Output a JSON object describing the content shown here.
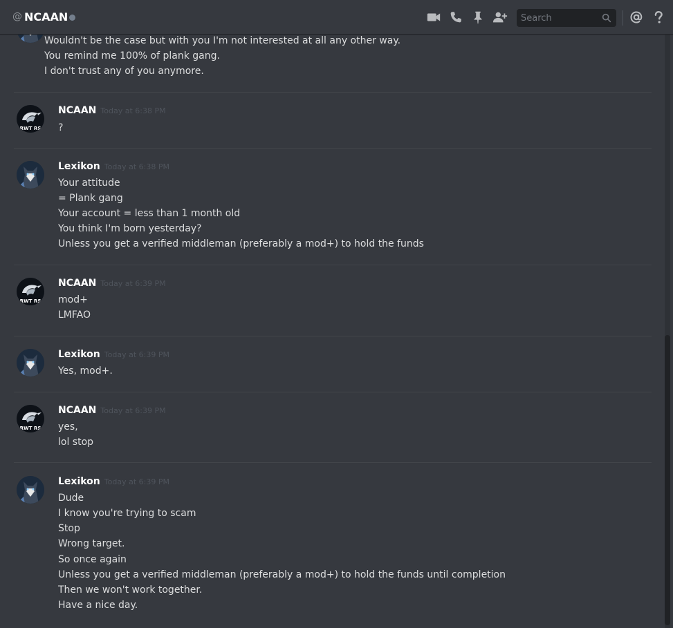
{
  "header": {
    "at_symbol": "@",
    "channel_name": "NCAAN",
    "search_placeholder": "Search",
    "icons": [
      "video-call-icon",
      "voice-call-icon",
      "pin-icon",
      "add-member-icon",
      "search-icon",
      "mention-icon",
      "help-icon"
    ]
  },
  "messages": {
    "top_partial": {
      "lines": [
        "Wouldn't be the case but with you I'm not interested at all any other way.",
        "You remind me 100% of plank gang.",
        "I don't trust any of you anymore."
      ]
    },
    "groups": [
      {
        "author": "NCAAN",
        "timestamp": "Today at 6:38 PM",
        "lines": [
          "?"
        ]
      },
      {
        "author": "Lexikon",
        "timestamp": "Today at 6:38 PM",
        "lines": [
          "Your attitude",
          "= Plank gang",
          "Your account = less than 1 month old",
          "You think I'm born yesterday?",
          "Unless you get a verified middleman (preferably a mod+) to hold the funds"
        ]
      },
      {
        "author": "NCAAN",
        "timestamp": "Today at 6:39 PM",
        "lines": [
          "mod+",
          "LMFAO"
        ]
      },
      {
        "author": "Lexikon",
        "timestamp": "Today at 6:39 PM",
        "lines": [
          "Yes, mod+."
        ]
      },
      {
        "author": "NCAAN",
        "timestamp": "Today at 6:39 PM",
        "lines": [
          "yes,",
          "lol stop"
        ]
      },
      {
        "author": "Lexikon",
        "timestamp": "Today at 6:39 PM",
        "lines": [
          "Dude",
          "I know you're trying to scam",
          "Stop",
          "Wrong target.",
          "So once again",
          "Unless you get a verified middleman (preferably a mod+) to hold the funds until completion",
          "Then we won't work together.",
          "Have a nice day."
        ]
      }
    ],
    "avatar_text_ncaan": "RWT RS"
  },
  "colors": {
    "background": "#36393f",
    "username": "#ffffff",
    "timestamp": "#4f545c",
    "text": "#dcddde"
  }
}
